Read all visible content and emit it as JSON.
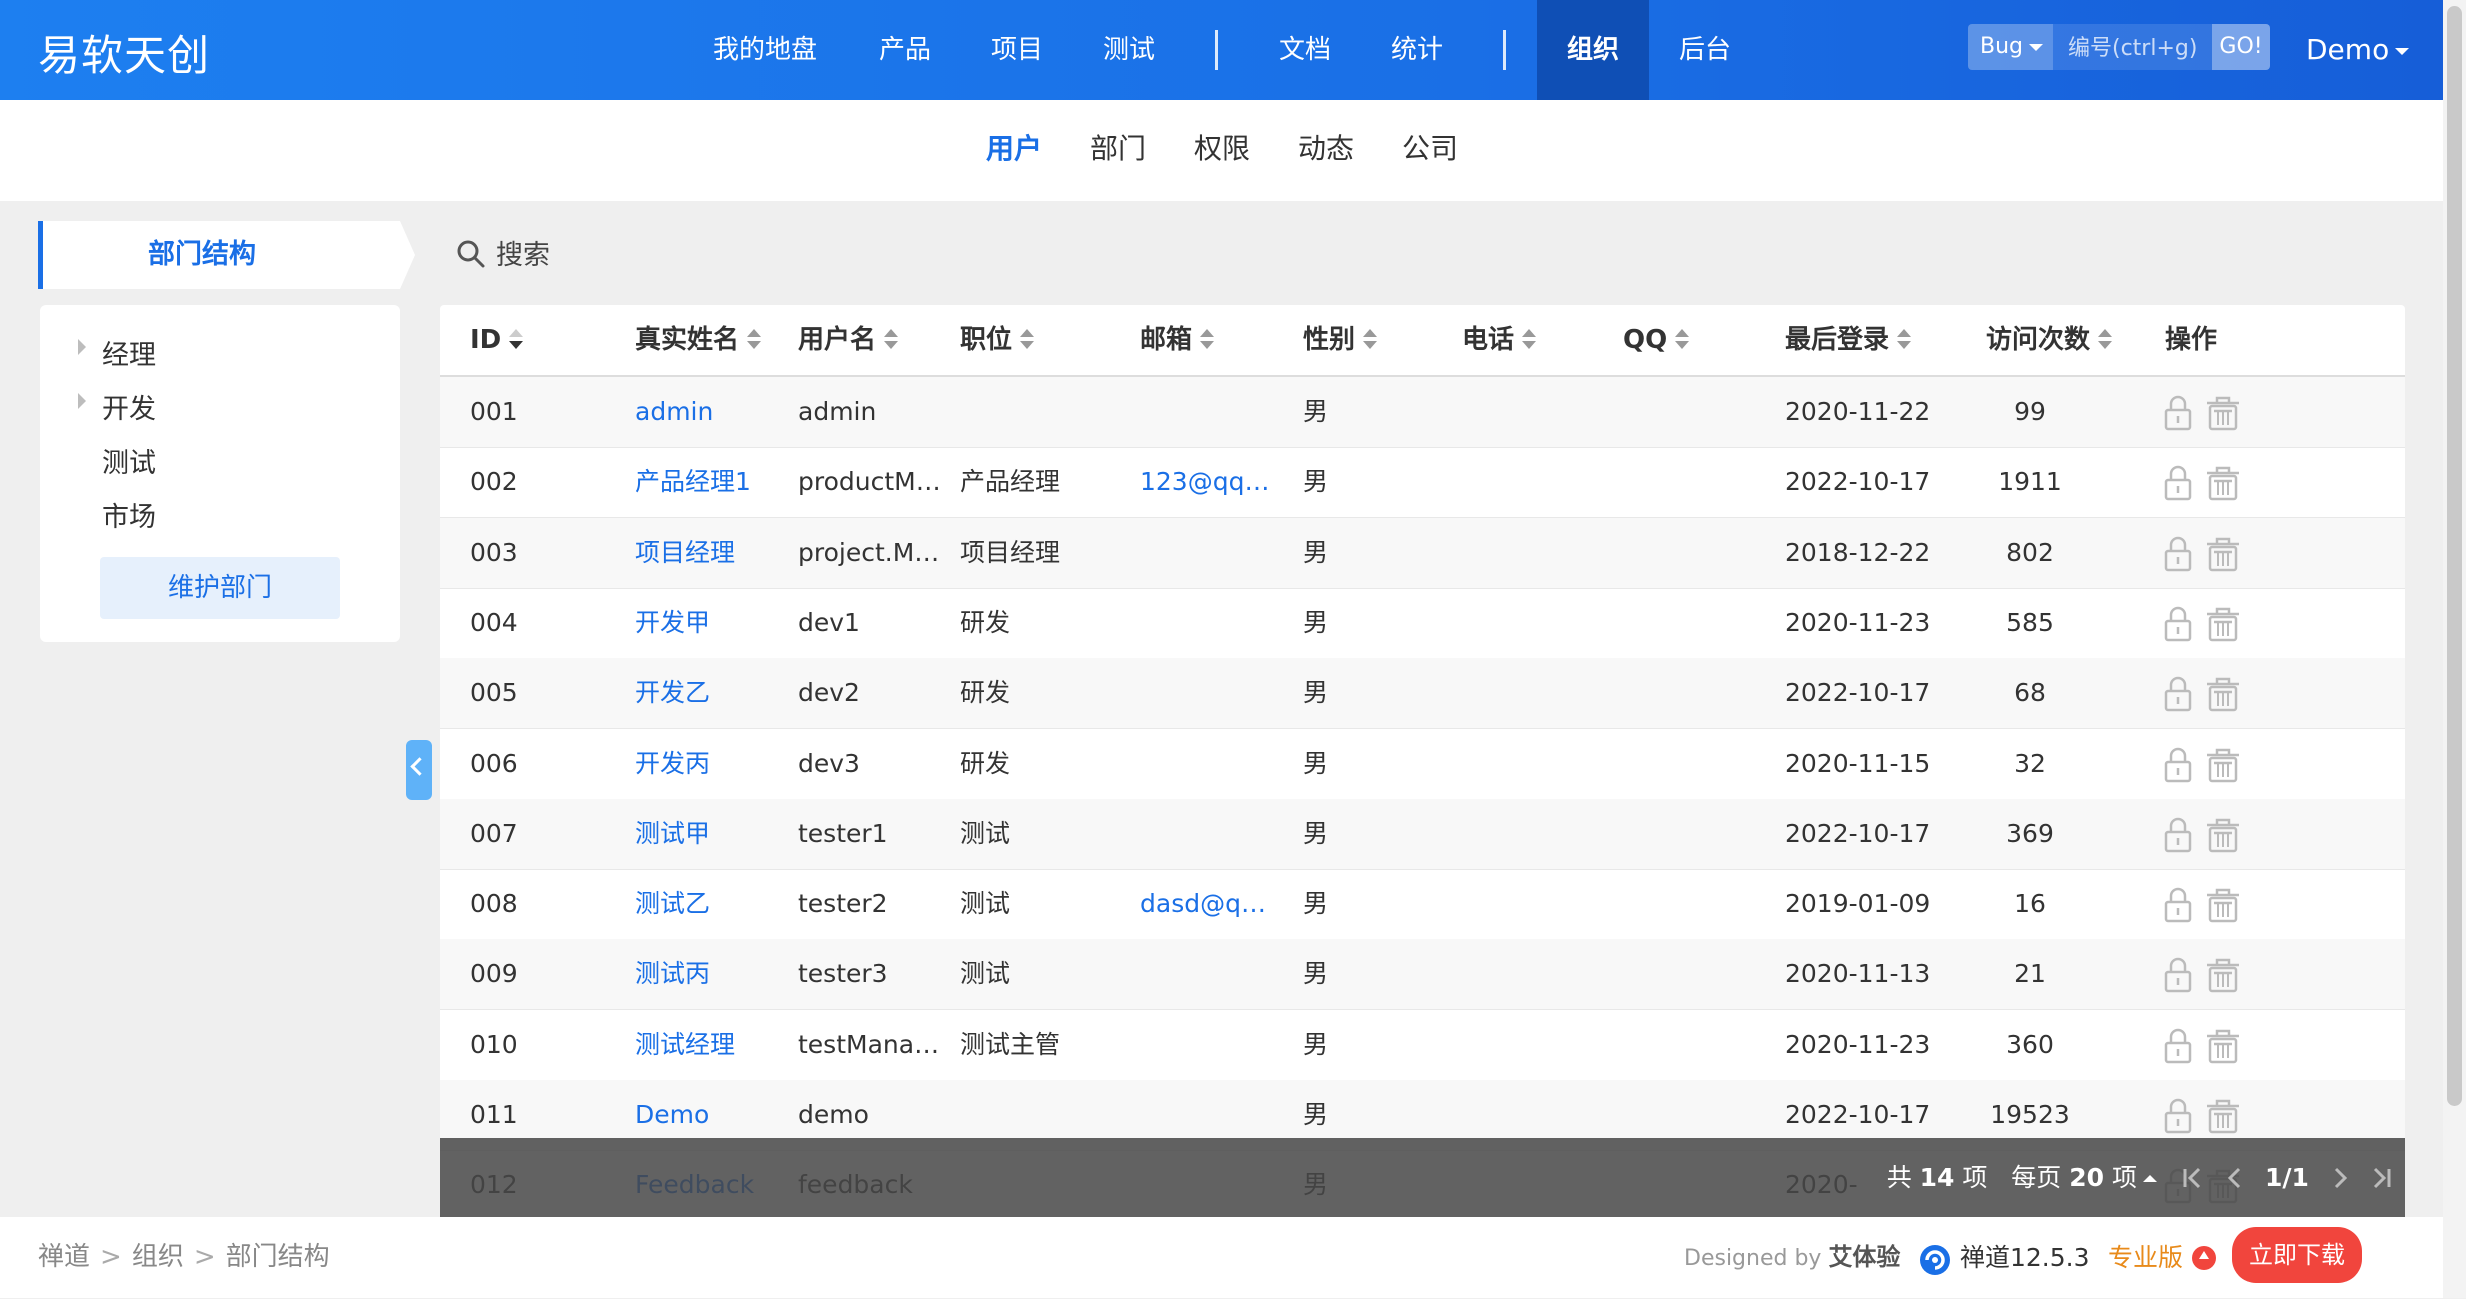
{
  "header": {
    "brand": "易软天创",
    "nav": [
      "我的地盘",
      "产品",
      "项目",
      "测试",
      "文档",
      "统计",
      "组织",
      "后台"
    ],
    "active_nav": "组织",
    "search": {
      "type": "Bug",
      "placeholder": "编号(ctrl+g)",
      "go": "GO!"
    },
    "user": "Demo"
  },
  "subnav": {
    "items": [
      "用户",
      "部门",
      "权限",
      "动态",
      "公司"
    ],
    "active": "用户"
  },
  "sidebar": {
    "title": "部门结构",
    "tree": [
      {
        "label": "经理",
        "expandable": true
      },
      {
        "label": "开发",
        "expandable": true
      },
      {
        "label": "测试",
        "expandable": false
      },
      {
        "label": "市场",
        "expandable": false
      }
    ],
    "maintain_button": "维护部门"
  },
  "main": {
    "search_label": "搜索",
    "columns": [
      "ID",
      "真实姓名",
      "用户名",
      "职位",
      "邮箱",
      "性别",
      "电话",
      "QQ",
      "最后登录",
      "访问次数",
      "操作"
    ],
    "rows": [
      {
        "id": "001",
        "realname": "admin",
        "account": "admin",
        "role": "",
        "email": "",
        "gender": "男",
        "phone": "",
        "qq": "",
        "last": "2020-11-22",
        "visits": "99"
      },
      {
        "id": "002",
        "realname": "产品经理1",
        "account": "productMana",
        "role": "产品经理",
        "email": "123@qq…",
        "gender": "男",
        "phone": "",
        "qq": "",
        "last": "2022-10-17",
        "visits": "1911"
      },
      {
        "id": "003",
        "realname": "项目经理",
        "account": "project.Mana",
        "role": "项目经理",
        "email": "",
        "gender": "男",
        "phone": "",
        "qq": "",
        "last": "2018-12-22",
        "visits": "802"
      },
      {
        "id": "004",
        "realname": "开发甲",
        "account": "dev1",
        "role": "研发",
        "email": "",
        "gender": "男",
        "phone": "",
        "qq": "",
        "last": "2020-11-23",
        "visits": "585"
      },
      {
        "id": "005",
        "realname": "开发乙",
        "account": "dev2",
        "role": "研发",
        "email": "",
        "gender": "男",
        "phone": "",
        "qq": "",
        "last": "2022-10-17",
        "visits": "68"
      },
      {
        "id": "006",
        "realname": "开发丙",
        "account": "dev3",
        "role": "研发",
        "email": "",
        "gender": "男",
        "phone": "",
        "qq": "",
        "last": "2020-11-15",
        "visits": "32"
      },
      {
        "id": "007",
        "realname": "测试甲",
        "account": "tester1",
        "role": "测试",
        "email": "",
        "gender": "男",
        "phone": "",
        "qq": "",
        "last": "2022-10-17",
        "visits": "369"
      },
      {
        "id": "008",
        "realname": "测试乙",
        "account": "tester2",
        "role": "测试",
        "email": "dasd@q…",
        "gender": "男",
        "phone": "",
        "qq": "",
        "last": "2019-01-09",
        "visits": "16"
      },
      {
        "id": "009",
        "realname": "测试丙",
        "account": "tester3",
        "role": "测试",
        "email": "",
        "gender": "男",
        "phone": "",
        "qq": "",
        "last": "2020-11-13",
        "visits": "21"
      },
      {
        "id": "010",
        "realname": "测试经理",
        "account": "testManager",
        "role": "测试主管",
        "email": "",
        "gender": "男",
        "phone": "",
        "qq": "",
        "last": "2020-11-23",
        "visits": "360"
      },
      {
        "id": "011",
        "realname": "Demo",
        "account": "demo",
        "role": "",
        "email": "",
        "gender": "男",
        "phone": "",
        "qq": "",
        "last": "2022-10-17",
        "visits": "19523"
      },
      {
        "id": "012",
        "realname": "Feedback",
        "account": "feedback",
        "role": "",
        "email": "",
        "gender": "男",
        "phone": "",
        "qq": "",
        "last": "2020-",
        "visits": ""
      }
    ]
  },
  "pager": {
    "total_prefix": "共",
    "total": "14",
    "total_suffix": "项",
    "per_prefix": "每页",
    "per_page": "20",
    "per_suffix": "项",
    "page": "1/1"
  },
  "footer": {
    "breadcrumb": [
      "禅道",
      "组织",
      "部门结构"
    ],
    "designed_prefix": "Designed by",
    "designed_by": "艾体验",
    "version": "禅道12.5.3",
    "edition": "专业版",
    "download": "立即下载"
  },
  "colors": {
    "brand": "#1a6fe6",
    "active_nav": "#0f4fb5",
    "download": "#f1453d",
    "edition": "#e88a1a"
  }
}
